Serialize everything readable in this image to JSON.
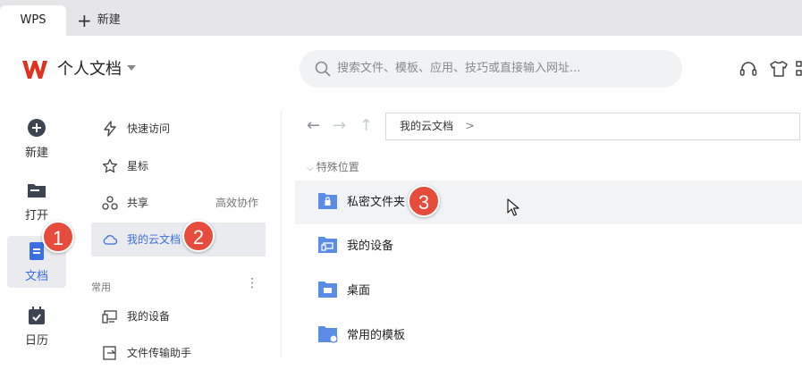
{
  "tabs": {
    "active": "WPS",
    "new_label": "新建"
  },
  "header": {
    "title": "个人文档",
    "search_placeholder": "搜索文件、模板、应用、技巧或直接输入网址..."
  },
  "rail": [
    {
      "label": "新建",
      "icon": "plus-circle-icon"
    },
    {
      "label": "打开",
      "icon": "folder-icon"
    },
    {
      "label": "文档",
      "icon": "document-icon",
      "active": true
    },
    {
      "label": "日历",
      "icon": "calendar-icon"
    }
  ],
  "nav": {
    "items": [
      {
        "label": "快速访问",
        "icon": "lightning-icon"
      },
      {
        "label": "星标",
        "icon": "star-icon"
      },
      {
        "label": "共享",
        "icon": "share-icon",
        "right": "高效协作"
      },
      {
        "label": "我的云文档",
        "icon": "cloud-icon",
        "active": true
      }
    ],
    "common_label": "常用",
    "common_items": [
      {
        "label": "我的设备",
        "icon": "device-icon"
      },
      {
        "label": "文件传输助手",
        "icon": "transfer-icon"
      }
    ]
  },
  "main": {
    "breadcrumb": "我的云文档",
    "breadcrumb_chevron": ">",
    "section": "特殊位置",
    "folders": [
      {
        "label": "私密文件夹",
        "icon": "lock-folder-icon"
      },
      {
        "label": "我的设备",
        "icon": "device-folder-icon"
      },
      {
        "label": "桌面",
        "icon": "desktop-folder-icon"
      },
      {
        "label": "常用的模板",
        "icon": "template-folder-icon"
      }
    ]
  },
  "badges": [
    "1",
    "2",
    "3"
  ],
  "colors": {
    "accent": "#3b6ee0",
    "badge": "#e64b3b",
    "wps_logo": "#e0331f",
    "folder": "#5b8de8"
  }
}
